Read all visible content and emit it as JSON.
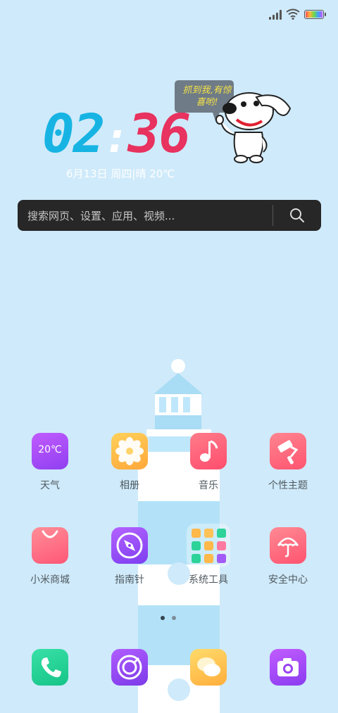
{
  "clock": {
    "hours": "02",
    "colon": ":",
    "minutes": "36"
  },
  "date_line": "6月13日 周四|晴 20℃",
  "mascot": {
    "speech": "抓到我,有惊喜哟!"
  },
  "search": {
    "placeholder": "搜索网页、设置、应用、视频..."
  },
  "apps_row1": [
    {
      "label": "天气",
      "icon": "weather-icon",
      "icon_text": "20℃"
    },
    {
      "label": "相册",
      "icon": "photos-flower-icon"
    },
    {
      "label": "音乐",
      "icon": "music-note-icon"
    },
    {
      "label": "个性主题",
      "icon": "paint-roller-icon"
    }
  ],
  "apps_row2": [
    {
      "label": "小米商城",
      "icon": "shopping-bag-icon"
    },
    {
      "label": "指南针",
      "icon": "compass-icon"
    },
    {
      "label": "系统工具",
      "icon": "folder-icon"
    },
    {
      "label": "安全中心",
      "icon": "umbrella-icon"
    }
  ],
  "dock": [
    {
      "icon": "phone-icon"
    },
    {
      "icon": "browser-icon"
    },
    {
      "icon": "messages-icon"
    },
    {
      "icon": "camera-icon"
    }
  ],
  "page_indicator": {
    "pages": 2,
    "current": 1
  },
  "colors": {
    "background": "#cfeafa",
    "clock_hours": "#17b4e3",
    "clock_minutes": "#e8325f",
    "search_bar": "#272727"
  }
}
